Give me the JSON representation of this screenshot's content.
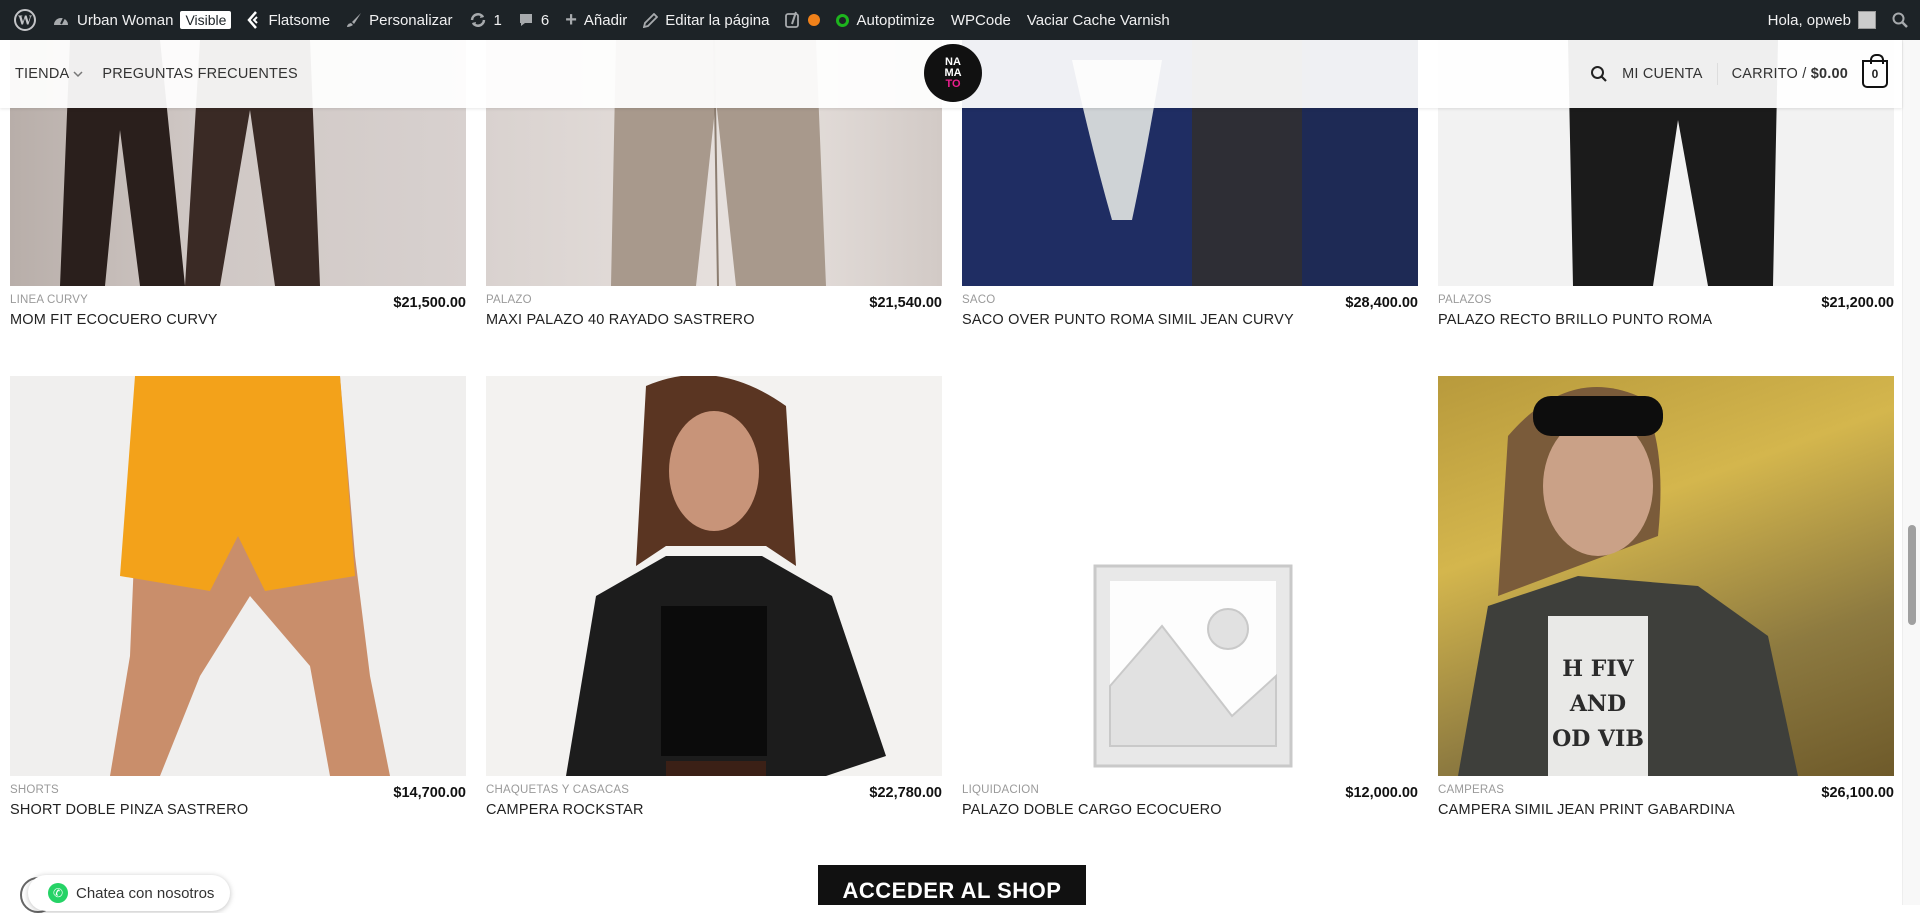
{
  "admin_bar": {
    "site_name": "Urban Woman",
    "visible_badge": "Visible",
    "theme": "Flatsome",
    "customize": "Personalizar",
    "updates_count": "1",
    "comments_count": "6",
    "add_new": "Añadir",
    "edit_page": "Editar la página",
    "autoptimize": "Autoptimize",
    "wpcode": "WPCode",
    "varnish": "Vaciar Cache Varnish",
    "greeting": "Hola, opweb"
  },
  "header": {
    "nav": [
      {
        "label": "TIENDA",
        "has_dropdown": true
      },
      {
        "label": "PREGUNTAS FRECUENTES"
      }
    ],
    "logo_lines": [
      "NA",
      "MA",
      "TO"
    ],
    "account": "MI CUENTA",
    "cart_label": "CARRITO /",
    "cart_total": "$0.00",
    "cart_count": "0"
  },
  "products": [
    {
      "category": "LINEA CURVY",
      "title": "MOM FIT ECOCUERO CURVY",
      "price": "$21,500.00"
    },
    {
      "category": "PALAZO",
      "title": "MAXI PALAZO 40 RAYADO SASTRERO",
      "price": "$21,540.00"
    },
    {
      "category": "SACO",
      "title": "SACO OVER PUNTO ROMA SIMIL JEAN CURVY",
      "price": "$28,400.00"
    },
    {
      "category": "PALAZOS",
      "title": "PALAZO RECTO BRILLO PUNTO ROMA",
      "price": "$21,200.00"
    },
    {
      "category": "SHORTS",
      "title": "SHORT DOBLE PINZA SASTRERO",
      "price": "$14,700.00"
    },
    {
      "category": "CHAQUETAS Y CASACAS",
      "title": "CAMPERA ROCKSTAR",
      "price": "$22,780.00"
    },
    {
      "category": "LIQUIDACION",
      "title": "PALAZO DOBLE CARGO ECOCUERO",
      "price": "$12,000.00"
    },
    {
      "category": "CAMPERAS",
      "title": "CAMPERA SIMIL JEAN PRINT GABARDINA",
      "price": "$26,100.00"
    }
  ],
  "shop_button": "ACCEDER AL SHOP",
  "chat": "Chatea con nosotros",
  "colors": {
    "admin_bar": "#1d2327",
    "button": "#111111",
    "logo_accent": "#e91e8c"
  }
}
